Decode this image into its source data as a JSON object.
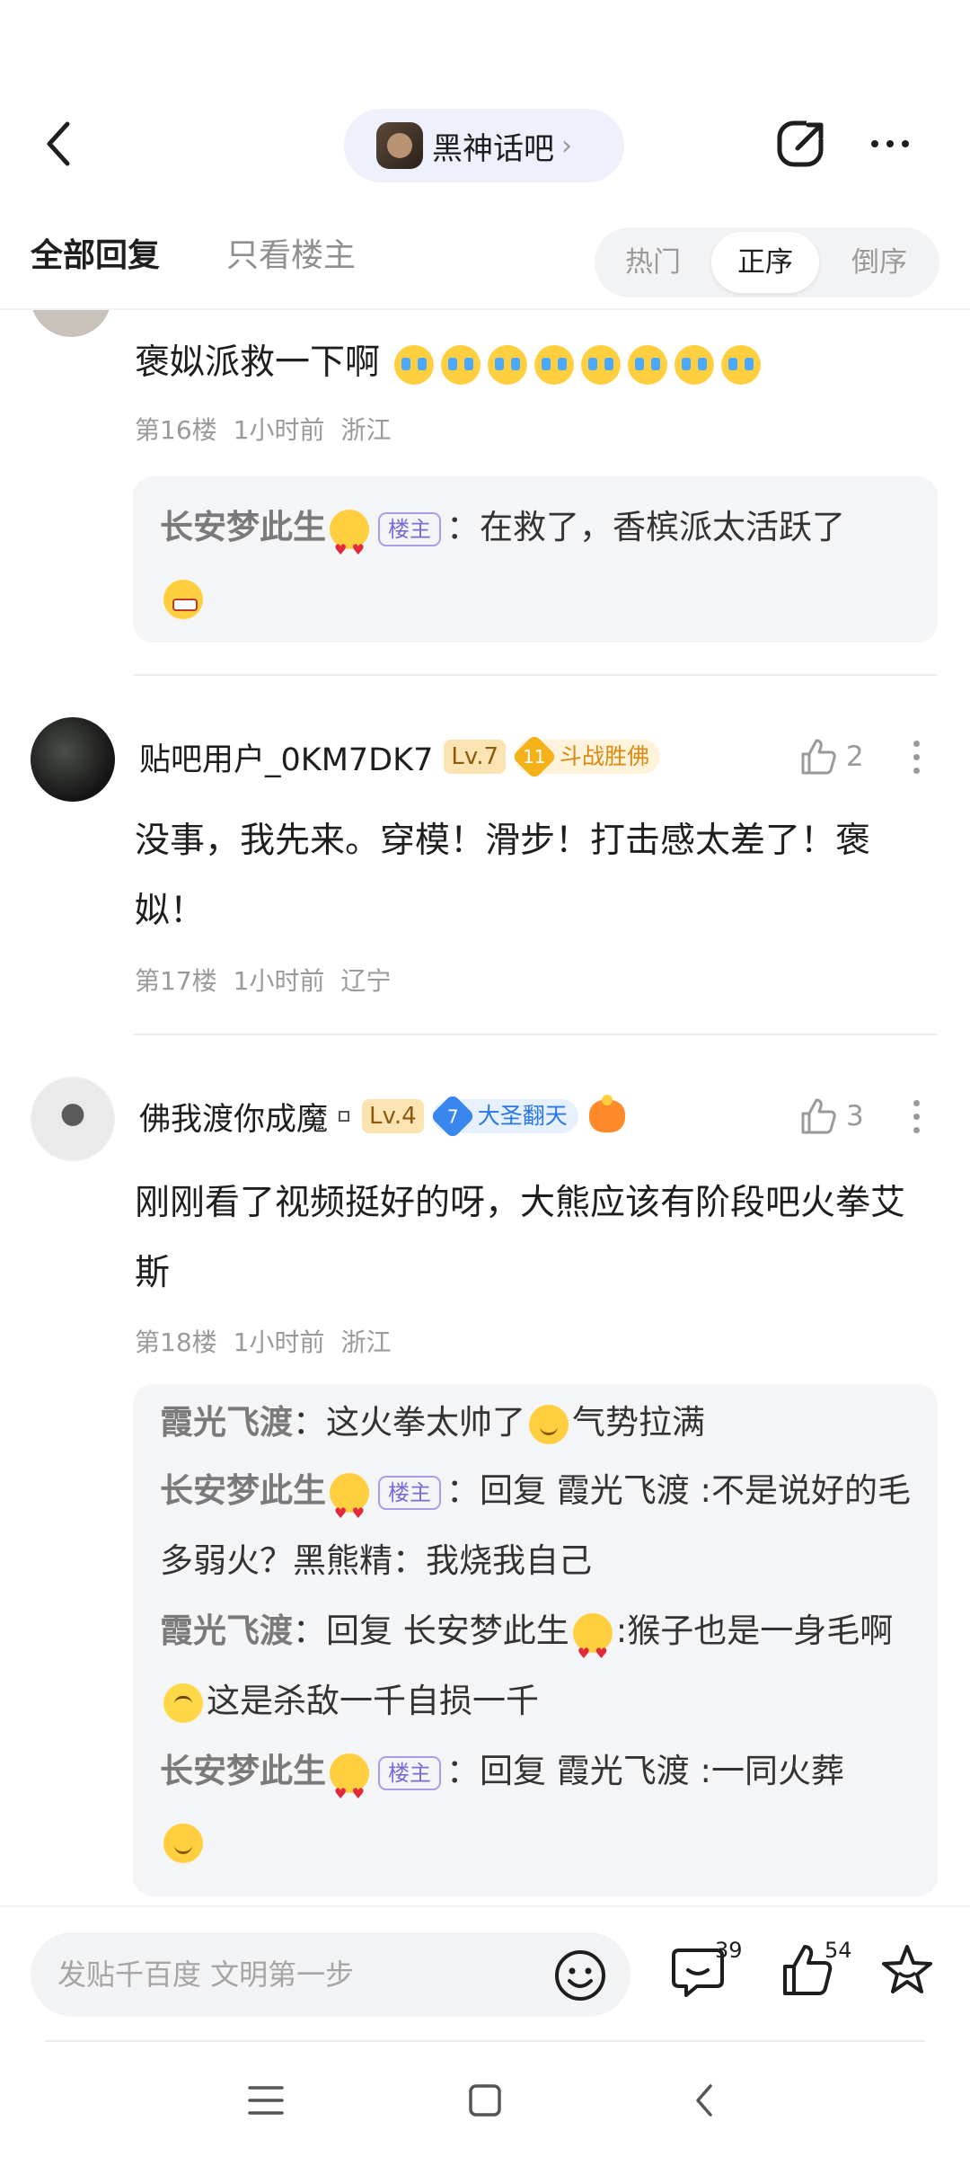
{
  "header": {
    "forum_name": "黑神话吧",
    "back_icon": "back-arrow-icon",
    "share_icon": "share-icon",
    "more_icon": "more-icon"
  },
  "tabs": {
    "all": "全部回复",
    "owner_only": "只看楼主",
    "sort": [
      "热门",
      "正序",
      "倒序"
    ],
    "selected_sort": "正序"
  },
  "floor16": {
    "text": "褒姒派救一下啊",
    "floor": "第16楼",
    "time": "1小时前",
    "location": "浙江",
    "reply": {
      "name": "长安梦此生",
      "tag": "楼主",
      "colon": "：",
      "text": "在救了，香槟派太活跃了"
    }
  },
  "floor17": {
    "username": "贴吧用户_0KM7DK7",
    "level": "Lv.7",
    "badge_num": "11",
    "badge_text": "斗战胜佛",
    "likes": "2",
    "text": "没事，我先来。穿模！滑步！打击感太差了！褒姒！",
    "floor": "第17楼",
    "time": "1小时前",
    "location": "辽宁"
  },
  "floor18": {
    "username": "佛我渡你成魔",
    "level": "Lv.4",
    "badge_num": "7",
    "badge_text": "大圣翻天",
    "likes": "3",
    "text": "刚刚看了视频挺好的呀，大熊应该有阶段吧火拳艾斯",
    "floor": "第18楼",
    "time": "1小时前",
    "location": "浙江",
    "replies": {
      "r1_name": "霞光飞渡",
      "r1_text_a": "这火拳太帅了",
      "r1_text_b": "气势拉满",
      "r2_name": "长安梦此生",
      "r2_tag": "楼主",
      "r2_text": "回复 霞光飞渡 :不是说好的毛多弱火？黑熊精：我烧我自己",
      "r3_name": "霞光飞渡",
      "r3_text_a": "回复 长安梦此生",
      "r3_text_b": ":猴子也是一身毛啊",
      "r3_text_c": "这是杀敌一千自损一千",
      "r4_name": "长安梦此生",
      "r4_tag": "楼主",
      "r4_text": "回复 霞光飞渡 :一同火葬",
      "colon": "："
    }
  },
  "bottom": {
    "input_placeholder": "发贴千百度 文明第一步",
    "comment_count": "39",
    "like_count": "54"
  },
  "colors": {
    "accent": "#7a6bd8",
    "gold_badge": "#f5b11a",
    "blue_badge": "#3a86ef"
  }
}
